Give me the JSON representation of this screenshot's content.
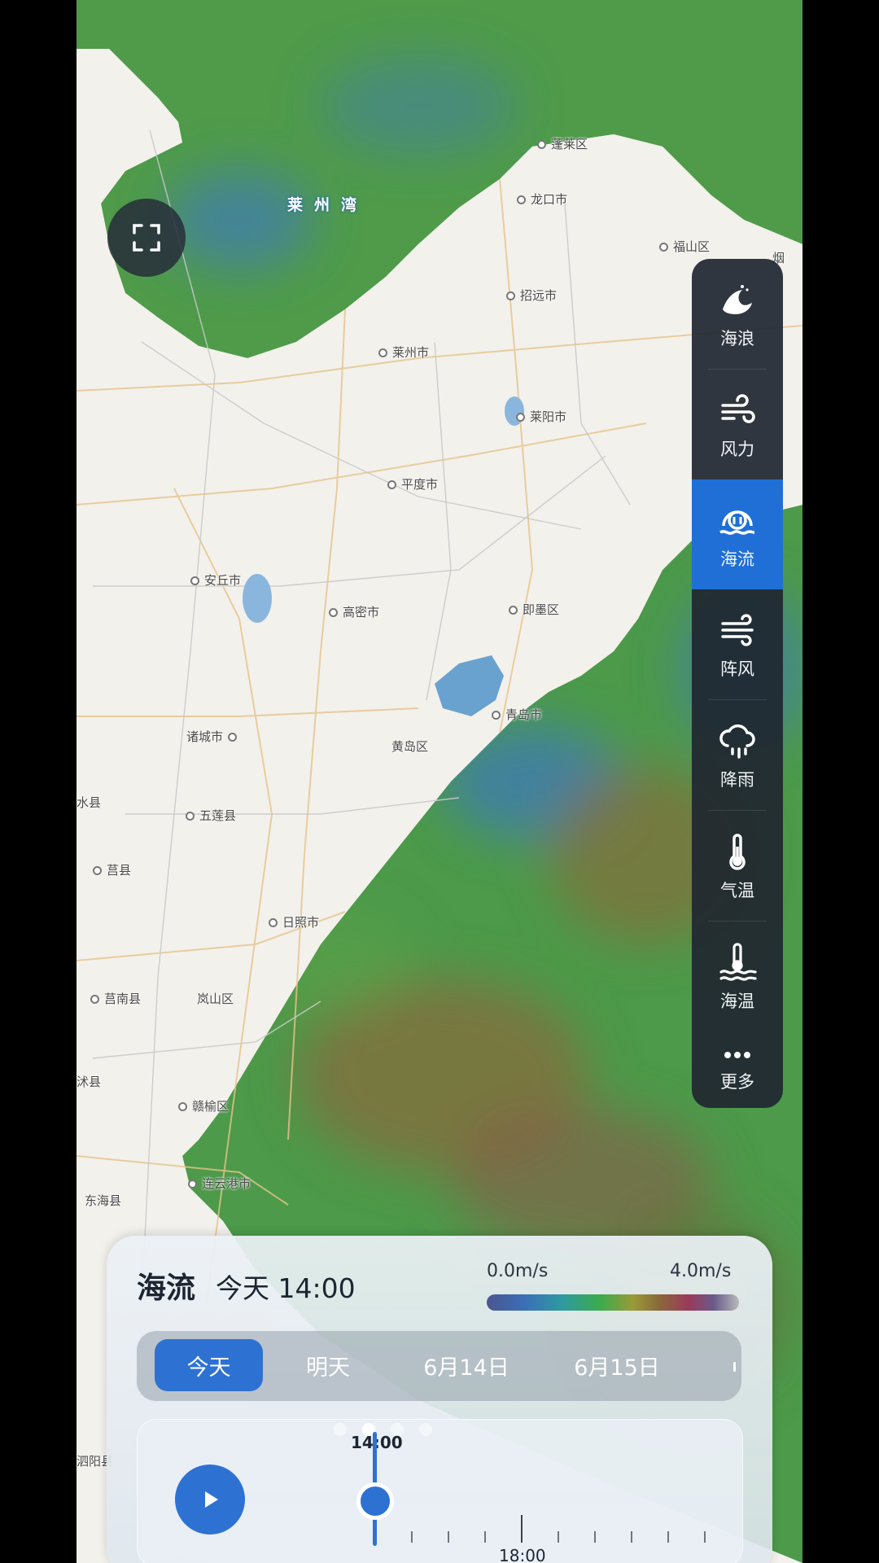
{
  "map": {
    "bay_label": "莱州湾",
    "cities": [
      {
        "name": "蓬莱区"
      },
      {
        "name": "龙口市"
      },
      {
        "name": "福山区"
      },
      {
        "name": "烟"
      },
      {
        "name": "招远市"
      },
      {
        "name": "莱州市"
      },
      {
        "name": "莱阳市"
      },
      {
        "name": "平度市"
      },
      {
        "name": "安丘市"
      },
      {
        "name": "高密市"
      },
      {
        "name": "即墨区"
      },
      {
        "name": "青岛市"
      },
      {
        "name": "黄岛区"
      },
      {
        "name": "诸城市"
      },
      {
        "name": "五莲县"
      },
      {
        "name": "水县"
      },
      {
        "name": "莒县"
      },
      {
        "name": "日照市"
      },
      {
        "name": "莒南县"
      },
      {
        "name": "岚山区"
      },
      {
        "name": "沭县"
      },
      {
        "name": "赣榆区"
      },
      {
        "name": "连云港市"
      },
      {
        "name": "东海县"
      },
      {
        "name": "泗阳县"
      }
    ]
  },
  "layers": [
    {
      "label": "海浪",
      "icon": "wave-icon",
      "active": false
    },
    {
      "label": "风力",
      "icon": "wind-icon",
      "active": false
    },
    {
      "label": "海流",
      "icon": "current-icon",
      "active": true
    },
    {
      "label": "阵风",
      "icon": "gust-icon",
      "active": false
    },
    {
      "label": "降雨",
      "icon": "rain-icon",
      "active": false
    },
    {
      "label": "气温",
      "icon": "thermometer-icon",
      "active": false
    },
    {
      "label": "海温",
      "icon": "sea-temperature-icon",
      "active": false
    },
    {
      "label": "更多",
      "icon": "more-icon",
      "active": false
    }
  ],
  "card": {
    "title": "海流",
    "time": "今天 14:00",
    "legend_min": "0.0m/s",
    "legend_max": "4.0m/s",
    "days": [
      "今天",
      "明天",
      "6月14日",
      "6月15日"
    ],
    "active_day": "今天",
    "current_time": "14:00",
    "next_label": "18:00"
  },
  "colors": {
    "accent": "#2d72d2",
    "panel": "#202630",
    "sea_green": "#4c9a4a",
    "sea_blue": "#3f7ab8",
    "sea_brown": "#8a6a3a"
  }
}
